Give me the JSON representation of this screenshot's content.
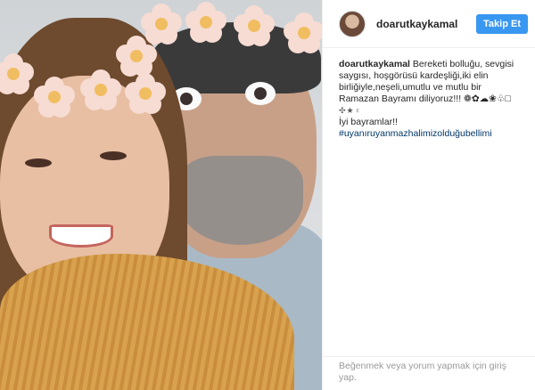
{
  "header": {
    "username": "doarutkaykamal",
    "follow_label": "Takip Et"
  },
  "caption": {
    "username": "doarutkaykamal",
    "lines": [
      "Bereketi bolluğu, sevgisi",
      "saygısı, hoşgörüsü kardeşliği,iki elin",
      "birliğiyle,neşeli,umutlu ve mutlu bir",
      "Ramazan Bayramı diliyoruz!!! ❁✿☁❀♧□",
      "✣★♀"
    ],
    "greeting": "İyi bayramlar!!",
    "hashtag": "#uyanıruyanmazhalimizolduğubellimi"
  },
  "footer": {
    "text": "Beğenmek veya yorum yapmak için",
    "link": "giriş yap."
  },
  "colors": {
    "follow_button": "#3897f0",
    "hashtag": "#003569",
    "muted": "#999999"
  }
}
